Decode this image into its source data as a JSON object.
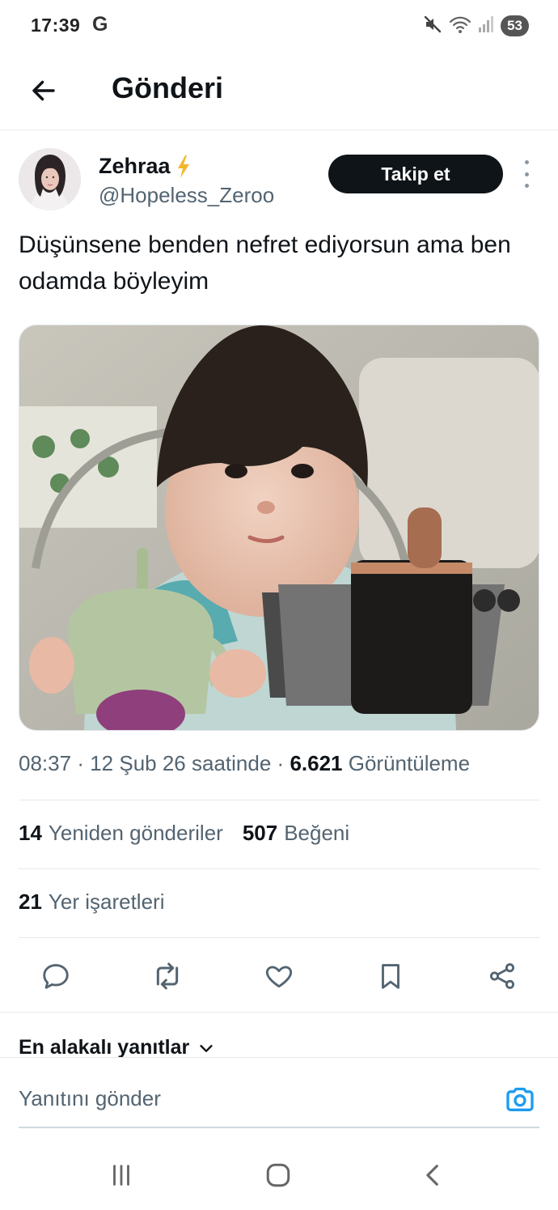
{
  "status_bar": {
    "time": "17:39",
    "carrier_icon": "G",
    "battery": "53",
    "icons": [
      "mute-icon",
      "wifi-icon",
      "signal-icon",
      "battery-icon"
    ]
  },
  "header": {
    "title": "Gönderi",
    "back_icon": "arrow-left-icon"
  },
  "post": {
    "author": {
      "name": "Zehraa",
      "badge_icon": "lightning-icon",
      "handle": "@Hopeless_Zeroo"
    },
    "follow_label": "Takip et",
    "text": "Düşünsene benden nefret ediyorsun ama ben odamda böyleyim",
    "meta": {
      "time": "08:37",
      "date": "12 Şub 26 saatinde",
      "views_count": "6.621",
      "views_label": "Görüntüleme",
      "separator": "·"
    },
    "stats": {
      "reposts_count": "14",
      "reposts_label": "Yeniden gönderiler",
      "likes_count": "507",
      "likes_label": "Beğeni",
      "bookmarks_count": "21",
      "bookmarks_label": "Yer işaretleri"
    }
  },
  "actions": [
    "reply-icon",
    "repost-icon",
    "like-icon",
    "bookmark-icon",
    "share-icon"
  ],
  "replies": {
    "sort_label": "En alakalı yanıtlar"
  },
  "reply_bar": {
    "placeholder": "Yanıtını gönder"
  },
  "colors": {
    "text_primary": "#0f1419",
    "text_secondary": "#536471",
    "accent": "#1d9bf0",
    "button_dark": "#0f1419",
    "badge": "#f5b72a"
  }
}
